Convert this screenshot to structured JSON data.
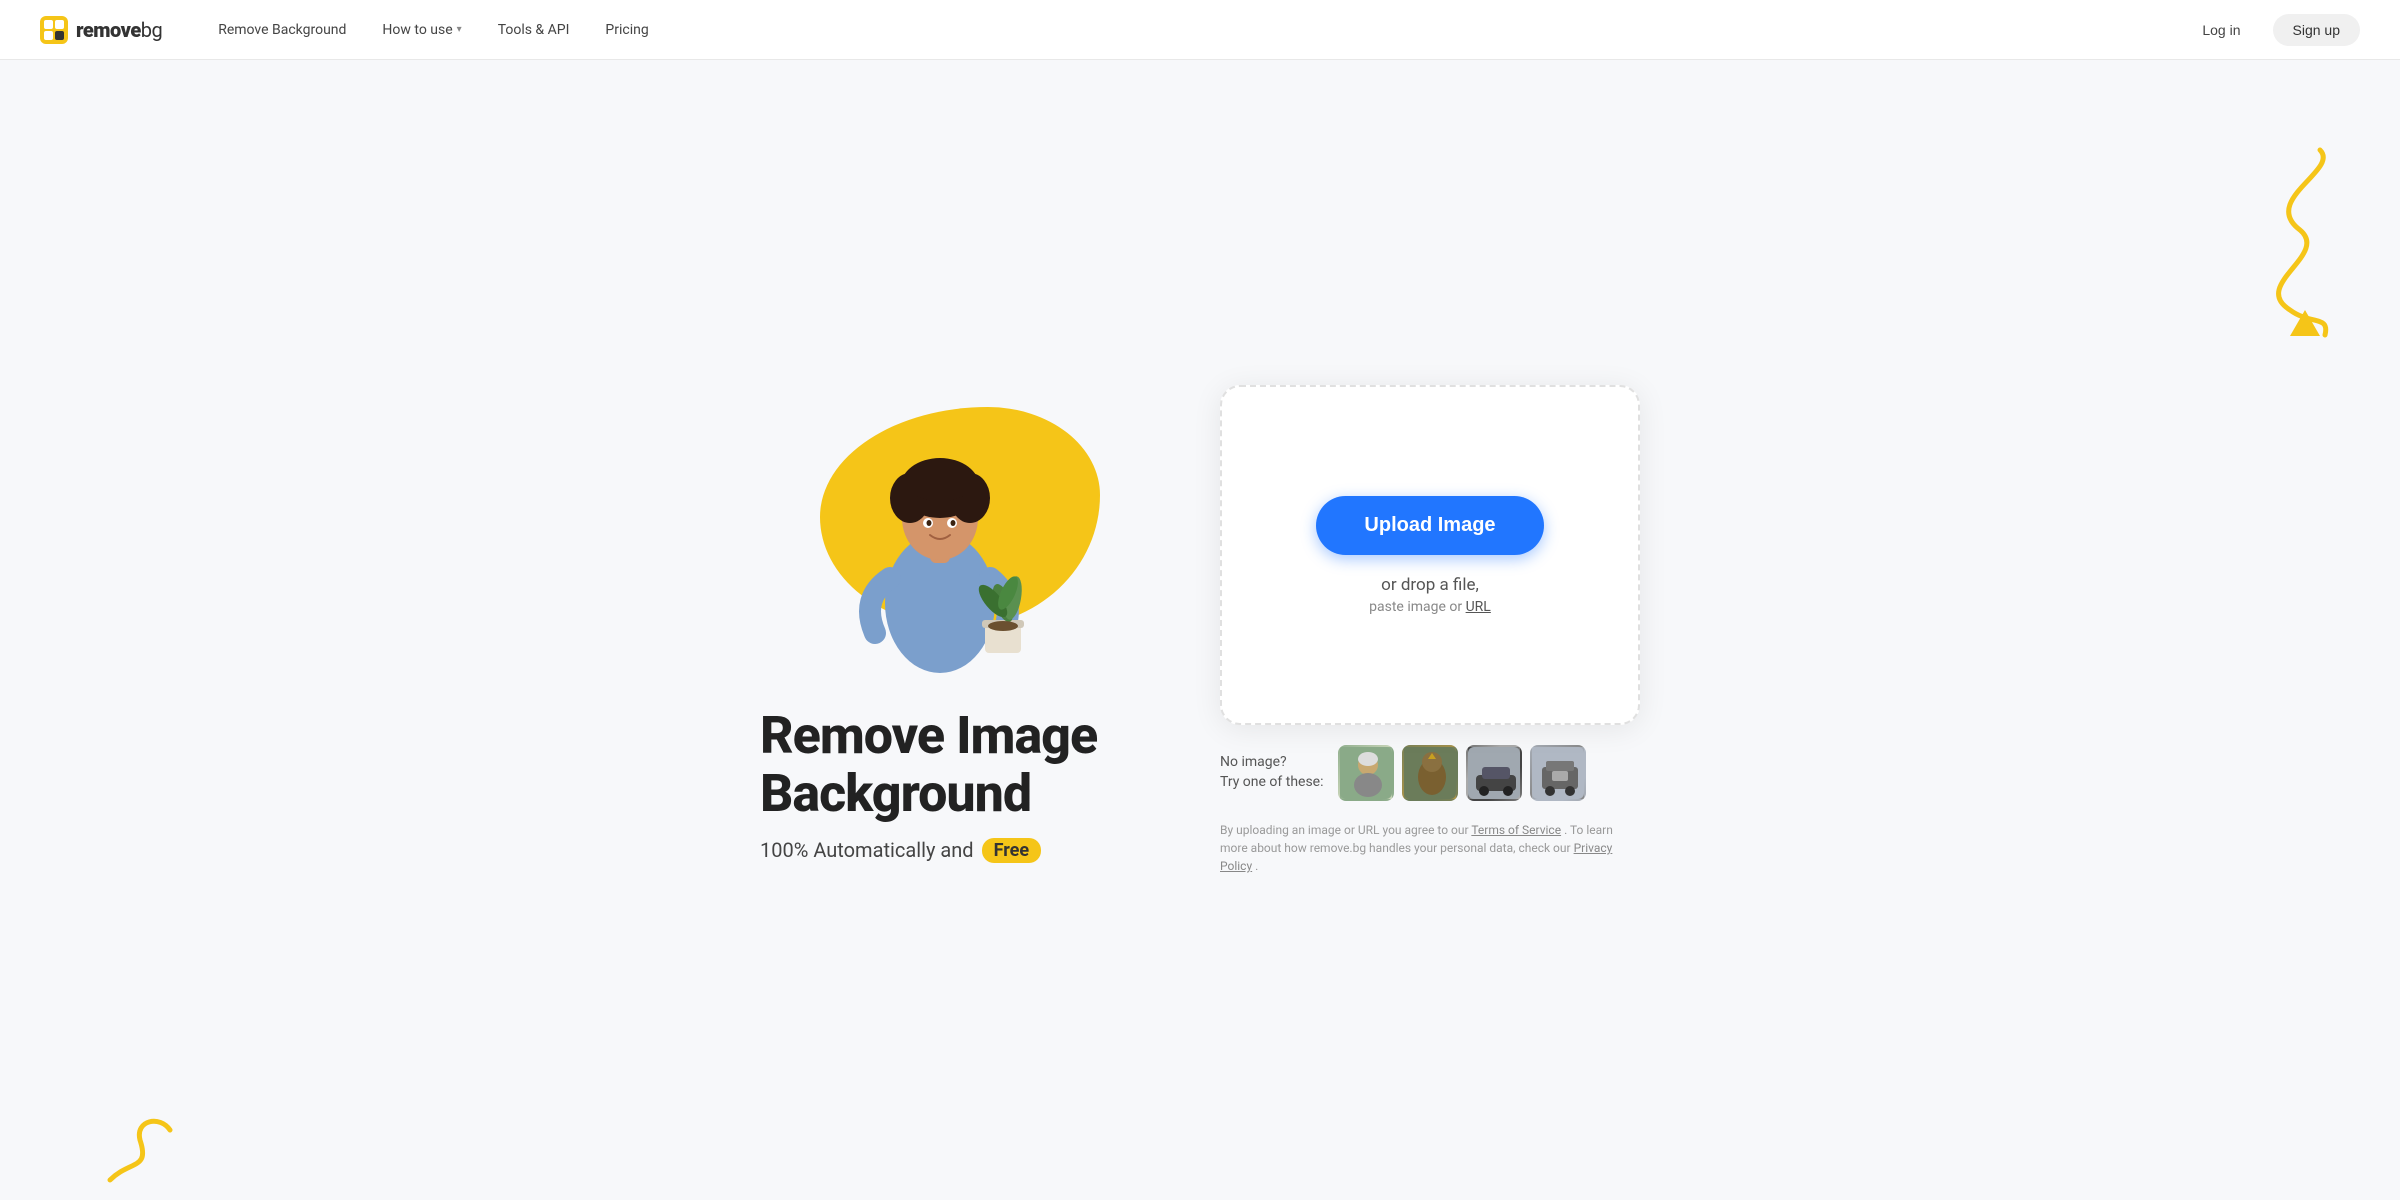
{
  "nav": {
    "logo_remove": "remove",
    "logo_bg": "bg",
    "links": [
      {
        "label": "Remove Background",
        "hasDropdown": false
      },
      {
        "label": "How to use",
        "hasDropdown": true
      },
      {
        "label": "Tools & API",
        "hasDropdown": false
      },
      {
        "label": "Pricing",
        "hasDropdown": false
      }
    ],
    "login_label": "Log in",
    "signup_label": "Sign up"
  },
  "hero": {
    "headline_line1": "Remove Image",
    "headline_line2": "Background",
    "subline_text": "100% Automatically and",
    "badge_text": "Free"
  },
  "upload": {
    "button_label": "Upload Image",
    "drop_text": "or drop a file,",
    "paste_text": "paste image or",
    "url_text": "URL"
  },
  "samples": {
    "no_image_label": "No image?",
    "try_label": "Try one of these:"
  },
  "legal": {
    "text1": "By uploading an image or URL you agree to our",
    "terms_link": "Terms of Service",
    "text2": ". To learn more about how remove.bg handles your personal data, check our",
    "privacy_link": "Privacy Policy",
    "text3": "."
  }
}
